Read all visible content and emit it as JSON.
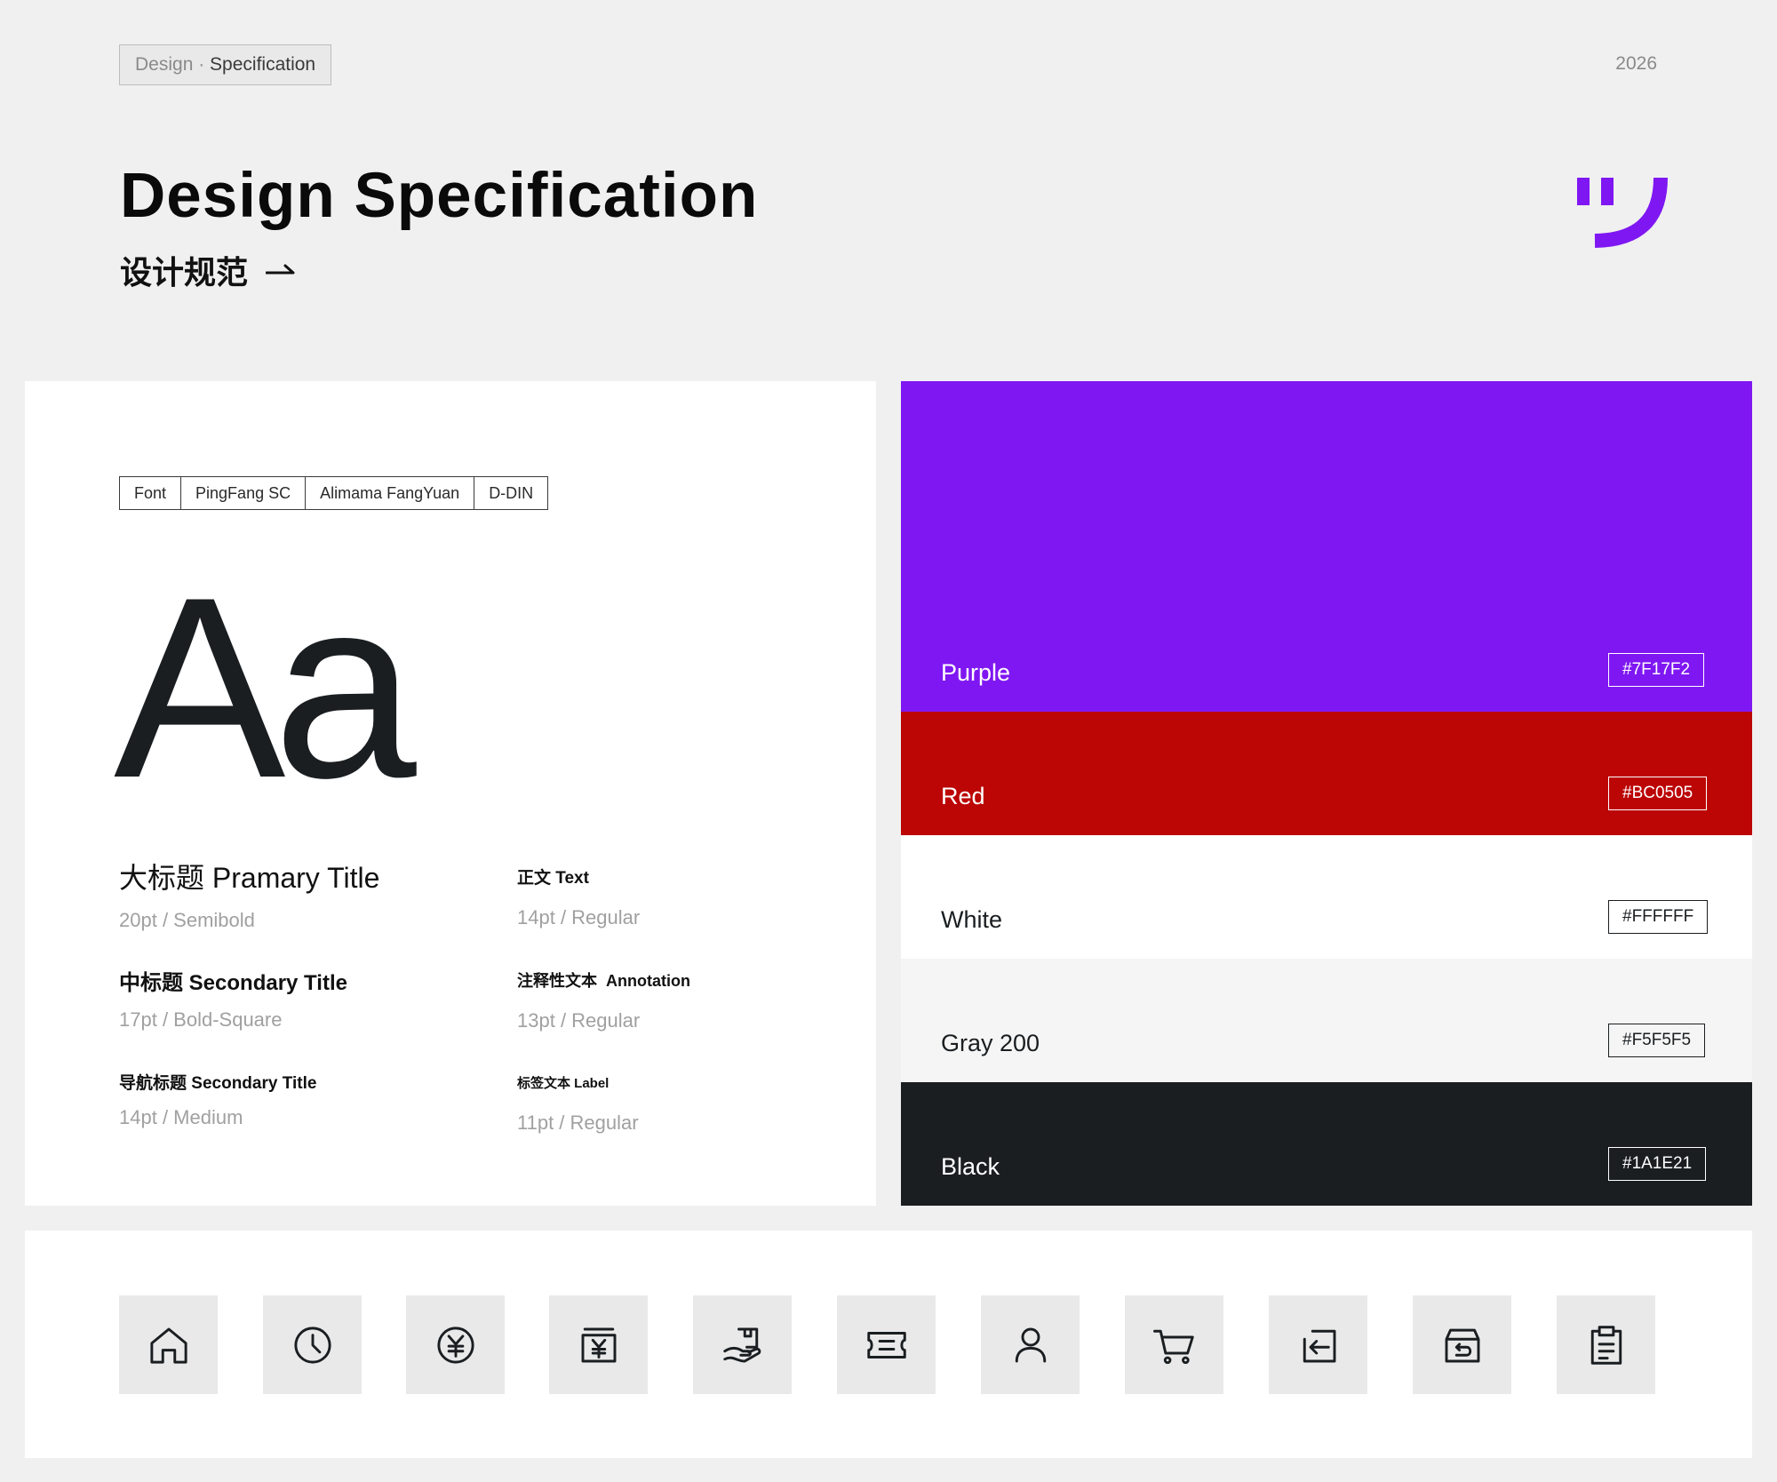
{
  "header": {
    "tag_prefix": "Design",
    "tag_separator": " · ",
    "tag_strong": "Specification",
    "year": "2026",
    "title": "Design Specification",
    "subtitle": "设计规范",
    "arrow_icon": "arrow-right-icon",
    "logo_icon": "brand-smile-logo",
    "logo_color": "#7F17F2"
  },
  "typography": {
    "font_tabs": [
      "Font",
      "PingFang SC",
      "Alimama FangYuan",
      "D-DIN"
    ],
    "sample": "Aa",
    "specs": [
      {
        "name": "大标题 Pramary Title",
        "size": "20pt",
        "weight": "Semibold"
      },
      {
        "name": "中标题 Secondary Title",
        "size": "17pt",
        "weight": "Bold-Square"
      },
      {
        "name": "导航标题 Secondary Title",
        "size": "14pt",
        "weight": "Medium"
      },
      {
        "name": "正文 Text",
        "size": "14pt",
        "weight": "Regular"
      },
      {
        "name": "注释性文本  Annotation",
        "size": "13pt",
        "weight": "Regular"
      },
      {
        "name": "标签文本 Label",
        "size": "11pt",
        "weight": "Regular"
      }
    ],
    "separator": " / "
  },
  "colors": [
    {
      "name": "Purple",
      "hex": "#7F17F2",
      "bg": "#7F17F2",
      "fg": "#FFFFFF"
    },
    {
      "name": "Red",
      "hex": "#BC0505",
      "bg": "#BC0505",
      "fg": "#FFFFFF"
    },
    {
      "name": "White",
      "hex": "#FFFFFF",
      "bg": "#FFFFFF",
      "fg": "#1A1E21"
    },
    {
      "name": "Gray 200",
      "hex": "#F5F5F5",
      "bg": "#F5F5F5",
      "fg": "#1A1E21"
    },
    {
      "name": "Black",
      "hex": "#1A1E21",
      "bg": "#1A1E21",
      "fg": "#FFFFFF"
    }
  ],
  "icons": [
    "home-icon",
    "clock-icon",
    "yuan-coin-icon",
    "yuan-receipt-icon",
    "hand-package-icon",
    "ticket-icon",
    "user-icon",
    "cart-icon",
    "return-arrow-icon",
    "return-box-icon",
    "clipboard-icon"
  ]
}
